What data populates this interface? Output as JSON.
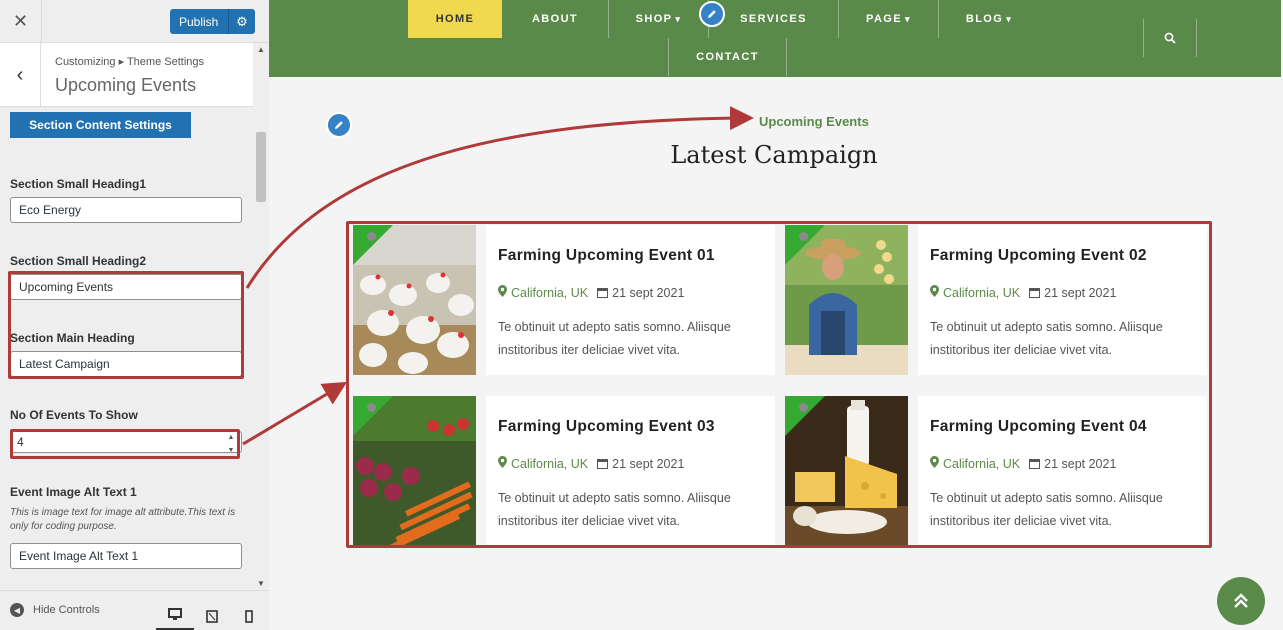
{
  "customizer": {
    "publish_label": "Publish",
    "breadcrumb": "Customizing ▸ Theme Settings",
    "panel_title": "Upcoming Events",
    "section_button": "Section Content Settings",
    "fields": {
      "small_heading1_label": "Section Small Heading1",
      "small_heading1_value": "Eco Energy",
      "small_heading2_label": "Section Small Heading2",
      "small_heading2_value": "Upcoming Events",
      "main_heading_label": "Section Main Heading",
      "main_heading_value": "Latest Campaign",
      "events_count_label": "No Of Events To Show",
      "events_count_value": "4",
      "alt_text_label": "Event Image Alt Text 1",
      "alt_text_desc": "This is image text for image alt attribute.This text is only for coding purpose.",
      "alt_text_value": "Event Image Alt Text 1"
    },
    "footer": {
      "hide_controls": "Hide Controls"
    }
  },
  "nav": {
    "items": [
      {
        "label": "HOME"
      },
      {
        "label": "ABOUT"
      },
      {
        "label": "SHOP"
      },
      {
        "label": "SERVICES"
      },
      {
        "label": "PAGE"
      },
      {
        "label": "BLOG"
      },
      {
        "label": "CONTACT"
      }
    ]
  },
  "section": {
    "small_heading1": "Eco Energy",
    "small_heading2": "Upcoming Events",
    "main_heading": "Latest Campaign"
  },
  "events": [
    {
      "title": "Farming Upcoming Event 01",
      "location": "California, UK",
      "date": "21 sept 2021",
      "desc": "Te obtinuit ut adepto satis somno. Aliisque institoribus iter deliciae vivet vita."
    },
    {
      "title": "Farming Upcoming Event 02",
      "location": "California, UK",
      "date": "21 sept 2021",
      "desc": "Te obtinuit ut adepto satis somno. Aliisque institoribus iter deliciae vivet vita."
    },
    {
      "title": "Farming Upcoming Event 03",
      "location": "California, UK",
      "date": "21 sept 2021",
      "desc": "Te obtinuit ut adepto satis somno. Aliisque institoribus iter deliciae vivet vita."
    },
    {
      "title": "Farming Upcoming Event 04",
      "location": "California, UK",
      "date": "21 sept 2021",
      "desc": "Te obtinuit ut adepto satis somno. Aliisque institoribus iter deliciae vivet vita."
    }
  ],
  "colors": {
    "brand_green": "#5a8a4a",
    "home_yellow": "#f1d94f",
    "wp_blue": "#2271b1",
    "highlight_red": "#b03a3a"
  }
}
